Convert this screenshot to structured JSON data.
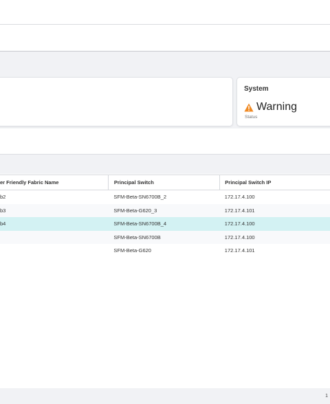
{
  "status_card": {
    "title": "System",
    "value": "Warning",
    "label": "Status"
  },
  "table": {
    "columns": [
      "er Friendly Fabric Name",
      "Principal Switch",
      "Principal Switch IP"
    ],
    "rows": [
      {
        "name": "b2",
        "switch": "SFM-Beta-SN6700B_2",
        "ip": "172.17.4.100"
      },
      {
        "name": "b3",
        "switch": "SFM-Beta-G620_3",
        "ip": "172.17.4.101"
      },
      {
        "name": "b4",
        "switch": "SFM-Beta-SN6700B_4",
        "ip": "172.17.4.100"
      },
      {
        "name": "",
        "switch": "SFM-Beta-SN6700B",
        "ip": "172.17.4.100"
      },
      {
        "name": "",
        "switch": "SFM-Beta-G620",
        "ip": "172.17.4.101"
      }
    ]
  },
  "pagination": {
    "page": "1"
  },
  "colors": {
    "warning": "#f08a24",
    "selected_row": "#d3f2f3"
  },
  "icons": {
    "status": "warning-triangle-icon"
  }
}
